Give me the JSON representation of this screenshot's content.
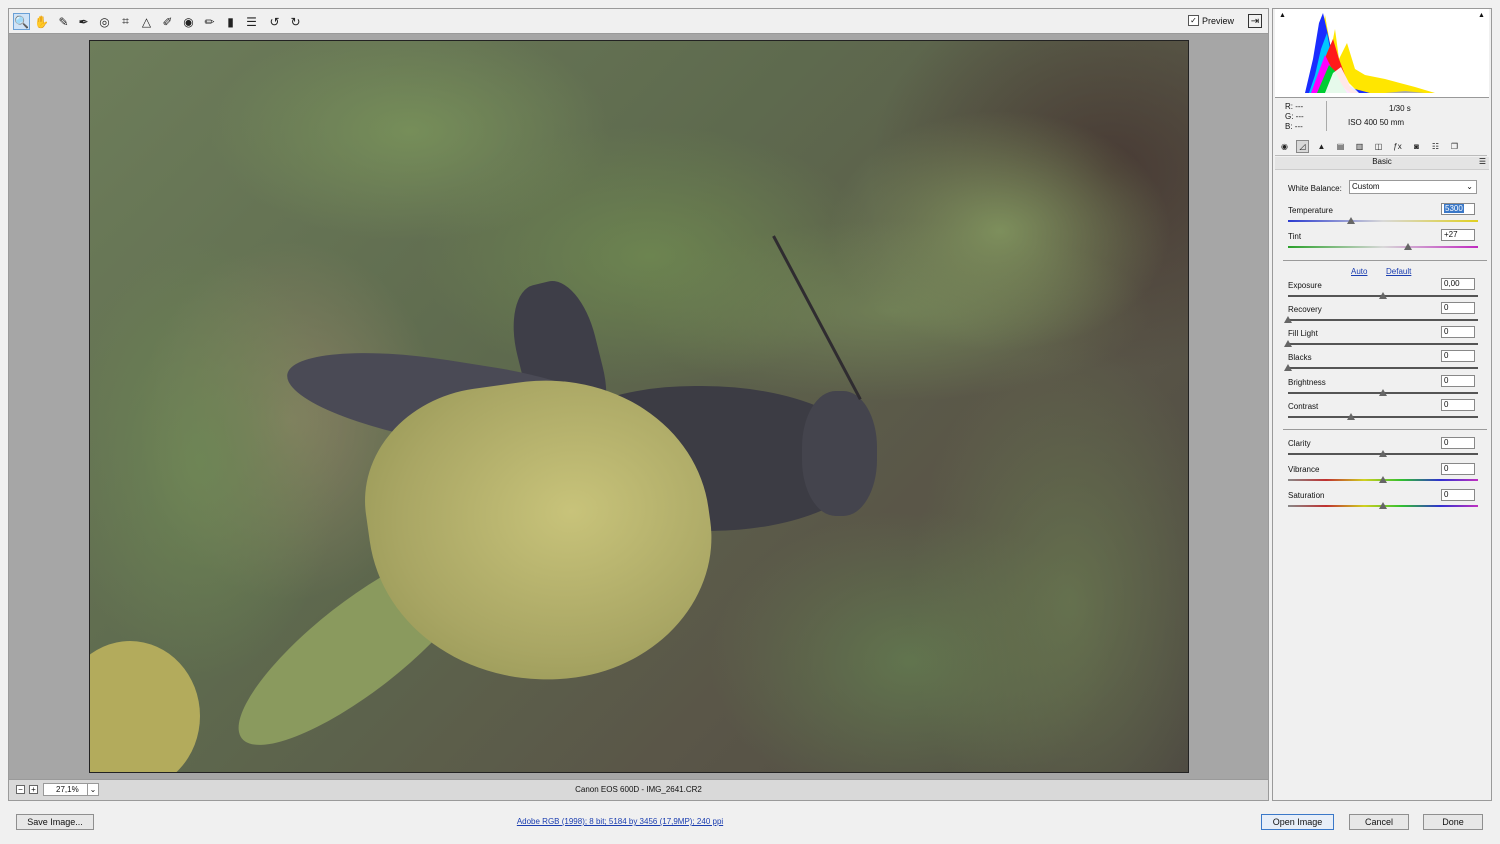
{
  "toolbar": {
    "tools": [
      {
        "icon": "zoom-icon",
        "glyph": "🔍"
      },
      {
        "icon": "hand-icon",
        "glyph": "✋"
      },
      {
        "icon": "white-balance-icon",
        "glyph": "✎"
      },
      {
        "icon": "color-sampler-icon",
        "glyph": "✒"
      },
      {
        "icon": "targeted-adjustment-icon",
        "glyph": "◎"
      },
      {
        "icon": "crop-icon",
        "glyph": "⌗"
      },
      {
        "icon": "straighten-icon",
        "glyph": "△"
      },
      {
        "icon": "spot-removal-icon",
        "glyph": "✐"
      },
      {
        "icon": "red-eye-icon",
        "glyph": "◉"
      },
      {
        "icon": "adjustment-brush-icon",
        "glyph": "✏"
      },
      {
        "icon": "graduated-filter-icon",
        "glyph": "▮"
      },
      {
        "icon": "preferences-icon",
        "glyph": "☰"
      },
      {
        "icon": "rotate-left-icon",
        "glyph": "↺"
      },
      {
        "icon": "rotate-right-icon",
        "glyph": "↻"
      }
    ],
    "preview_label": "Preview",
    "preview_checked": "✓"
  },
  "status": {
    "zoom_out": "−",
    "zoom_in": "+",
    "zoom": "27,1%",
    "filename": "Canon EOS 600D  -  IMG_2641.CR2"
  },
  "panel": {
    "rgb": {
      "r": "R:   ---",
      "g": "G:   ---",
      "b": "B:   ---"
    },
    "shutter": "1/30 s",
    "iso_focal": "ISO 400    50 mm",
    "section": "Basic",
    "white_balance_label": "White Balance:",
    "white_balance_value": "Custom",
    "auto": "Auto",
    "default": "Default",
    "sliders": [
      {
        "label": "Temperature",
        "value": "5300",
        "pos": 0.33
      },
      {
        "label": "Tint",
        "value": "+27",
        "pos": 0.63
      },
      {
        "label": "Exposure",
        "value": "0,00",
        "pos": 0.5
      },
      {
        "label": "Recovery",
        "value": "0",
        "pos": 0.0
      },
      {
        "label": "Fill Light",
        "value": "0",
        "pos": 0.0
      },
      {
        "label": "Blacks",
        "value": "0",
        "pos": 0.0
      },
      {
        "label": "Brightness",
        "value": "0",
        "pos": 0.5
      },
      {
        "label": "Contrast",
        "value": "0",
        "pos": 0.33
      },
      {
        "label": "Clarity",
        "value": "0",
        "pos": 0.5
      },
      {
        "label": "Vibrance",
        "value": "0",
        "pos": 0.5
      },
      {
        "label": "Saturation",
        "value": "0",
        "pos": 0.5
      }
    ],
    "tab_icons": [
      "basic-tab-icon",
      "tone-curve-tab-icon",
      "detail-tab-icon",
      "hsl-tab-icon",
      "split-toning-tab-icon",
      "lens-corrections-tab-icon",
      "effects-tab-icon",
      "camera-calibration-tab-icon",
      "presets-tab-icon",
      "settings-tab-icon",
      "snapshots-tab-icon"
    ]
  },
  "bottom": {
    "save": "Save Image...",
    "workflow": "Adobe RGB (1998); 8 bit; 5184 by 3456 (17,9MP); 240 ppi",
    "open": "Open Image",
    "cancel": "Cancel",
    "done": "Done"
  },
  "colors": {
    "accent": "#3a78c8",
    "link": "#1a3db0"
  }
}
